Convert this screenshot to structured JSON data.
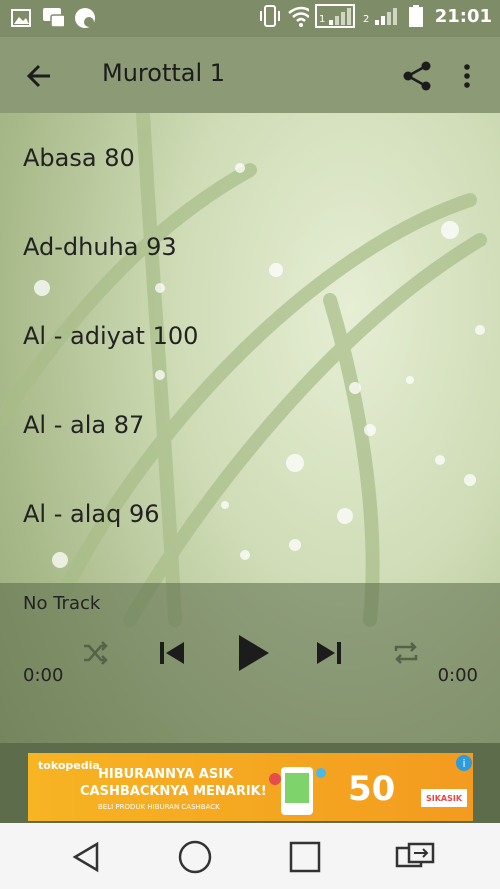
{
  "status_bar": {
    "time": "21:01",
    "icons": [
      "image-icon",
      "chat-icon",
      "app-icon",
      "vibrate-icon",
      "wifi-icon",
      "signal-1-icon",
      "signal-2-icon",
      "battery-icon"
    ]
  },
  "toolbar": {
    "title": "Murottal 1",
    "icons": [
      "back-arrow-icon",
      "share-icon",
      "more-vert-icon"
    ]
  },
  "tracks": [
    {
      "label": "Abasa 80"
    },
    {
      "label": "Ad-dhuha 93"
    },
    {
      "label": "Al - adiyat 100"
    },
    {
      "label": "Al - ala 87"
    },
    {
      "label": "Al - alaq 96"
    }
  ],
  "player": {
    "track_name": "No Track",
    "time_elapsed": "0:00",
    "time_total": "0:00",
    "icons": [
      "shuffle-icon",
      "previous-icon",
      "play-icon",
      "next-icon",
      "repeat-icon"
    ]
  },
  "ad": {
    "brand": "tokopedia",
    "line1": "HIBURANNYA ASIK",
    "line2": "CASHBACKNYA MENARIK!",
    "line3": "BELI PRODUK HIBURAN CASHBACK",
    "big": "50",
    "cta": "SIKASIK",
    "icons": [
      "ad-info-icon",
      "ad-close-icon"
    ]
  },
  "nav_bar": {
    "icons": [
      "nav-back-icon",
      "nav-home-icon",
      "nav-recents-icon",
      "nav-switch-icon"
    ]
  }
}
